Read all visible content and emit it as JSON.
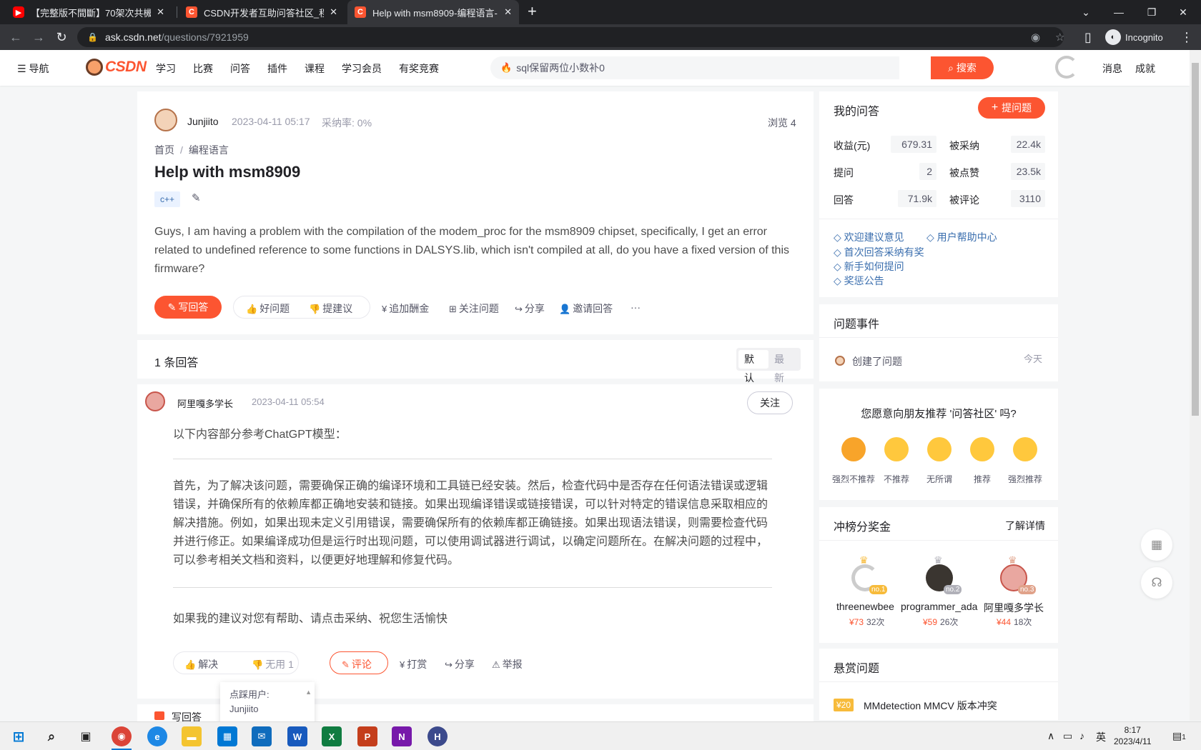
{
  "browser": {
    "tabs": [
      {
        "label": "【完整版不間斷】70架次共機台",
        "favicon": "youtube-icon"
      },
      {
        "label": "CSDN开发者互助问答社区_程序",
        "favicon": "csdn-icon"
      },
      {
        "label": "Help with msm8909-编程语言-",
        "favicon": "csdn-icon"
      }
    ],
    "url_host": "ask.csdn.net",
    "url_path": "/questions/7921959",
    "incognito_label": "Incognito"
  },
  "header": {
    "nav_label": "导航",
    "logo_text": "CSDN",
    "menu": [
      "学习",
      "比赛",
      "问答",
      "插件",
      "课程",
      "学习会员",
      "有奖竞赛"
    ],
    "search_placeholder": "sql保留两位小数补0",
    "search_button": "搜索",
    "messages": "消息",
    "achievements": "成就"
  },
  "question": {
    "author": "Junjiito",
    "time": "2023-04-11 05:17",
    "accept_rate": "采纳率: 0%",
    "views": "浏览 4",
    "breadcrumb": [
      "首页",
      "编程语言"
    ],
    "title": "Help with msm8909",
    "tag": "c++",
    "body": "Guys, I am having a problem with the compilation of the modem_proc for the msm8909 chipset, specifically, I get an error related to undefined reference to some functions in DALSYS.lib, which isn't compiled at all, do you have a fixed version of this firmware?",
    "actions": {
      "write_answer": "写回答",
      "good_question": "好问题",
      "suggest": "提建议",
      "add_bounty": "追加酬金",
      "follow": "关注问题",
      "share": "分享",
      "invite": "邀请回答",
      "more": "···"
    }
  },
  "answers_header": {
    "count": "1 条回答",
    "sort_default": "默认",
    "sort_latest": "最新"
  },
  "answer": {
    "author": "阿里嘎多学长",
    "time": "2023-04-11 05:54",
    "follow_button": "关注",
    "intro": "以下内容部分参考ChatGPT模型：",
    "paragraph": "首先，为了解决该问题，需要确保正确的编译环境和工具链已经安装。然后，检查代码中是否存在任何语法错误或逻辑错误，并确保所有的依赖库都正确地安装和链接。如果出现编译错误或链接错误，可以针对特定的错误信息采取相应的解决措施。例如，如果出现未定义引用错误，需要确保所有的依赖库都正确链接。如果出现语法错误，则需要检查代码并进行修正。如果编译成功但是运行时出现问题，可以使用调试器进行调试，以确定问题所在。在解决问题的过程中，可以参考相关文档和资料，以便更好地理解和修复代码。",
    "closing": "如果我的建议对您有帮助、请点击采纳、祝您生活愉快",
    "actions": {
      "solve": "解决",
      "useless": "无用 1",
      "comment": "评论",
      "reward": "打赏",
      "share": "分享",
      "report": "举报"
    },
    "tooltip_title": "点踩用户:",
    "tooltip_user": "Junjiito"
  },
  "next_section_label": "写回答",
  "sidebar": {
    "my_qa_title": "我的问答",
    "ask_button": "提问题",
    "stats": [
      {
        "label": "收益(元)",
        "value": "679.31"
      },
      {
        "label": "被采纳",
        "value": "22.4k"
      },
      {
        "label": "提问",
        "value": "2"
      },
      {
        "label": "被点赞",
        "value": "23.5k"
      },
      {
        "label": "回答",
        "value": "71.9k"
      },
      {
        "label": "被评论",
        "value": "3110"
      }
    ],
    "links": [
      "欢迎建议意见",
      "用户帮助中心",
      "首次回答采纳有奖",
      "新手如何提问",
      "奖惩公告"
    ],
    "events_title": "问题事件",
    "event_text": "创建了问题",
    "event_time": "今天",
    "recommend_question": "您愿意向朋友推荐 '问答社区' 吗?",
    "recommend_options": [
      "强烈不推荐",
      "不推荐",
      "无所谓",
      "推荐",
      "强烈推荐"
    ],
    "bonus_title": "冲榜分奖金",
    "bonus_link": "了解详情",
    "ranking": [
      {
        "name": "threenewbee",
        "badge": "no.1",
        "money": "¥73",
        "times": "32次"
      },
      {
        "name": "programmer_ada",
        "badge": "no.2",
        "money": "¥59",
        "times": "26次"
      },
      {
        "name": "阿里嘎多学长",
        "badge": "no.3",
        "money": "¥44",
        "times": "18次"
      }
    ],
    "bounty_title": "悬赏问题",
    "bounty_tag": "¥20",
    "bounty_question": "MMdetection MMCV 版本冲突"
  },
  "taskbar": {
    "ime": "英",
    "time": "8:17",
    "date": "2023/4/11",
    "notifications": "1"
  }
}
